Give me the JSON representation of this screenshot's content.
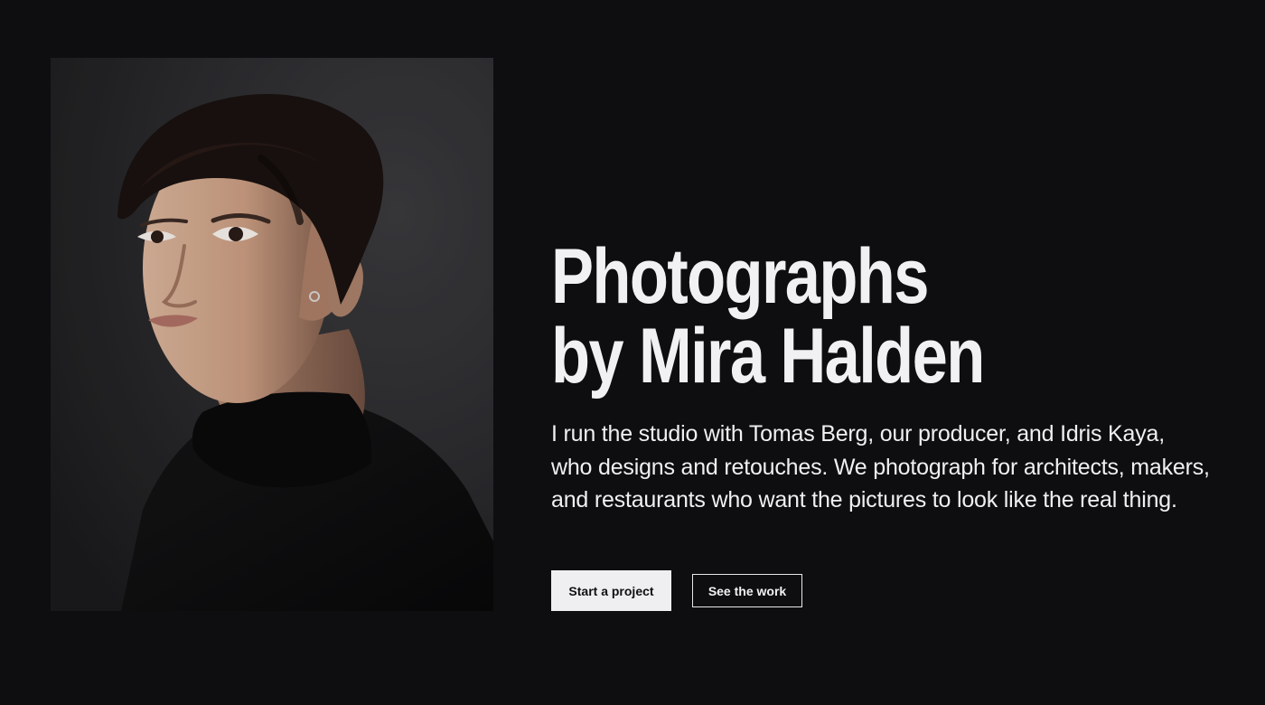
{
  "hero": {
    "title_line_1": "Photographs",
    "title_line_2": "by Mira Halden",
    "description": "I run the studio with Tomas Berg, our producer, and Idris Kaya, who designs and retouches. We photograph for architects, makers, and restaurants who want the pictures to look like the real thing."
  },
  "actions": {
    "primary_label": "Start a project",
    "secondary_label": "See the work"
  },
  "colors": {
    "background": "#0e0e11",
    "text": "#f1f1f3",
    "primary_button_bg": "#efeff1",
    "primary_button_text": "#111114"
  }
}
